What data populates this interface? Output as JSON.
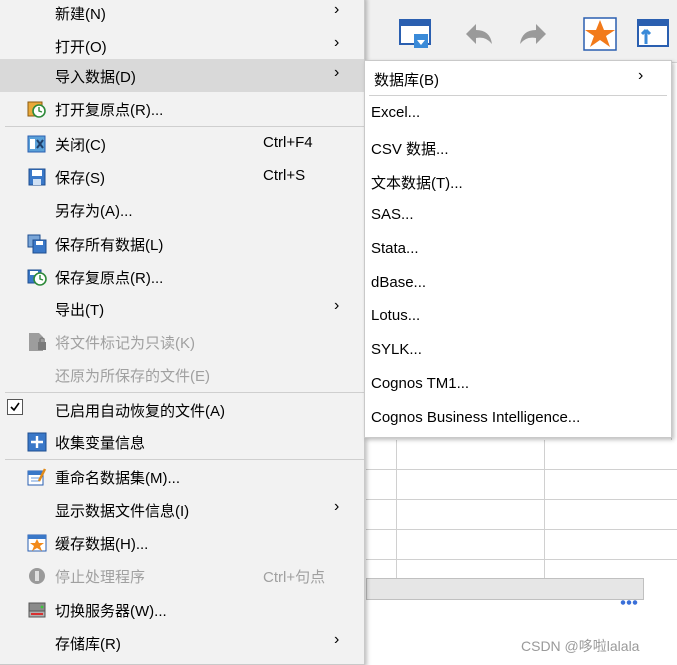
{
  "main_menu": {
    "items": [
      {
        "label": "新建(N)",
        "arrow": "›"
      },
      {
        "label": "打开(O)",
        "arrow": "›"
      },
      {
        "label": "导入数据(D)",
        "arrow": "›"
      },
      {
        "label": "打开复原点(R)..."
      },
      {
        "label": "关闭(C)",
        "shortcut": "Ctrl+F4"
      },
      {
        "label": "保存(S)",
        "shortcut": "Ctrl+S"
      },
      {
        "label": "另存为(A)..."
      },
      {
        "label": "保存所有数据(L)"
      },
      {
        "label": "保存复原点(R)..."
      },
      {
        "label": "导出(T)",
        "arrow": "›"
      },
      {
        "label": "将文件标记为只读(K)"
      },
      {
        "label": "还原为所保存的文件(E)"
      },
      {
        "label": "已启用自动恢复的文件(A)"
      },
      {
        "label": "收集变量信息"
      },
      {
        "label": "重命名数据集(M)..."
      },
      {
        "label": "显示数据文件信息(I)",
        "arrow": "›"
      },
      {
        "label": "缓存数据(H)..."
      },
      {
        "label": "停止处理程序",
        "shortcut": "Ctrl+句点"
      },
      {
        "label": "切换服务器(W)..."
      },
      {
        "label": "存储库(R)",
        "arrow": "›"
      }
    ]
  },
  "sub_menu": {
    "items": [
      {
        "label": "数据库(B)",
        "arrow": "›"
      },
      {
        "label": "Excel..."
      },
      {
        "label": "CSV 数据..."
      },
      {
        "label": "文本数据(T)..."
      },
      {
        "label": "SAS..."
      },
      {
        "label": "Stata..."
      },
      {
        "label": "dBase..."
      },
      {
        "label": "Lotus..."
      },
      {
        "label": "SYLK..."
      },
      {
        "label": "Cognos TM1..."
      },
      {
        "label": "Cognos Business Intelligence..."
      }
    ]
  },
  "watermark": "CSDN @哆啦lalala",
  "colors": {
    "highlight": "#d9d9d9",
    "menu_bg": "#f2f2f2",
    "disabled": "#a0a0a0"
  }
}
